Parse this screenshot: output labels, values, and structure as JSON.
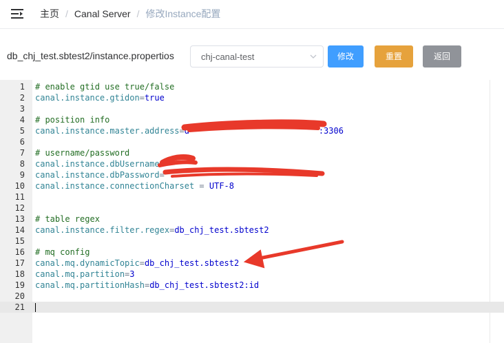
{
  "breadcrumb": {
    "items": [
      {
        "label": "主页"
      },
      {
        "label": "Canal Server"
      },
      {
        "label": "修改Instance配置"
      }
    ]
  },
  "toolbar": {
    "file_name": "db_chj_test.sbtest2/instance.propertios",
    "cluster_select_value": "chj-canal-test",
    "edit_label": "修改",
    "reset_label": "重置",
    "back_label": "返回"
  },
  "editor": {
    "lines": [
      {
        "n": "1",
        "parts": [
          {
            "t": "# enable gtid use true/false",
            "c": "comment"
          }
        ]
      },
      {
        "n": "2",
        "parts": [
          {
            "t": "canal.instance.gtidon",
            "c": "key"
          },
          {
            "t": "=",
            "c": "op"
          },
          {
            "t": "true",
            "c": "val"
          }
        ]
      },
      {
        "n": "3",
        "parts": []
      },
      {
        "n": "4",
        "parts": [
          {
            "t": "# position info",
            "c": "comment"
          }
        ]
      },
      {
        "n": "5",
        "parts": [
          {
            "t": "canal.instance.master.address",
            "c": "key"
          },
          {
            "t": "=",
            "c": "op"
          },
          {
            "t": "d",
            "c": "val"
          },
          {
            "t": "                          ",
            "c": "val"
          },
          {
            "t": ":3306",
            "c": "val"
          }
        ]
      },
      {
        "n": "6",
        "parts": []
      },
      {
        "n": "7",
        "parts": [
          {
            "t": "# username/password",
            "c": "comment"
          }
        ]
      },
      {
        "n": "8",
        "parts": [
          {
            "t": "canal.instance.dbUsername",
            "c": "key"
          },
          {
            "t": "=",
            "c": "op"
          }
        ]
      },
      {
        "n": "9",
        "parts": [
          {
            "t": "canal.instance.dbPassword",
            "c": "key"
          },
          {
            "t": "=",
            "c": "op"
          }
        ]
      },
      {
        "n": "10",
        "parts": [
          {
            "t": "canal.instance.connectionCharset",
            "c": "key"
          },
          {
            "t": " = ",
            "c": "op"
          },
          {
            "t": "UTF-8",
            "c": "val"
          }
        ]
      },
      {
        "n": "11",
        "parts": []
      },
      {
        "n": "12",
        "parts": []
      },
      {
        "n": "13",
        "parts": [
          {
            "t": "# table regex",
            "c": "comment"
          }
        ]
      },
      {
        "n": "14",
        "parts": [
          {
            "t": "canal.instance.filter.regex",
            "c": "key"
          },
          {
            "t": "=",
            "c": "op"
          },
          {
            "t": "db_chj_test.sbtest2",
            "c": "val"
          }
        ]
      },
      {
        "n": "15",
        "parts": []
      },
      {
        "n": "16",
        "parts": [
          {
            "t": "# mq config",
            "c": "comment"
          }
        ]
      },
      {
        "n": "17",
        "parts": [
          {
            "t": "canal.mq.dynamicTopic",
            "c": "key"
          },
          {
            "t": "=",
            "c": "op"
          },
          {
            "t": "db_chj_test.sbtest2",
            "c": "val"
          }
        ]
      },
      {
        "n": "18",
        "parts": [
          {
            "t": "canal.mq.partition",
            "c": "key"
          },
          {
            "t": "=",
            "c": "op"
          },
          {
            "t": "3",
            "c": "lit"
          }
        ]
      },
      {
        "n": "19",
        "parts": [
          {
            "t": "canal.mq.partitionHash",
            "c": "key"
          },
          {
            "t": "=",
            "c": "op"
          },
          {
            "t": "db_chj_test.sbtest2:id",
            "c": "val"
          }
        ]
      },
      {
        "n": "20",
        "parts": []
      },
      {
        "n": "21",
        "parts": []
      }
    ],
    "active_line": "21"
  },
  "colors": {
    "primary": "#409eff",
    "warning": "#e6a23c",
    "info": "#909399",
    "annotation": "#e8392a"
  },
  "icons": {
    "menu": "hamburger-icon",
    "select_arrow": "chevron-down-icon"
  }
}
